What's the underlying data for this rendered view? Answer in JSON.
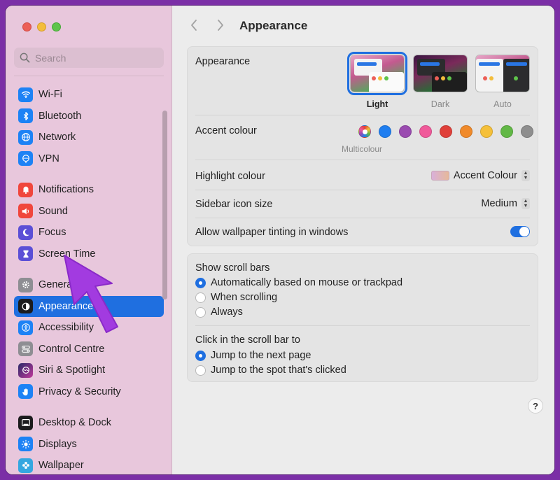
{
  "search": {
    "placeholder": "Search"
  },
  "sidebar": {
    "groups": [
      [
        {
          "label": "Wi-Fi",
          "icon": "wifi-icon",
          "color": "#1d82f5"
        },
        {
          "label": "Bluetooth",
          "icon": "bluetooth-icon",
          "color": "#1d82f5"
        },
        {
          "label": "Network",
          "icon": "globe-icon",
          "color": "#1d82f5"
        },
        {
          "label": "VPN",
          "icon": "vpn-icon",
          "color": "#1d82f5"
        }
      ],
      [
        {
          "label": "Notifications",
          "icon": "bell-icon",
          "color": "#f0463c"
        },
        {
          "label": "Sound",
          "icon": "speaker-icon",
          "color": "#f0463c"
        },
        {
          "label": "Focus",
          "icon": "moon-icon",
          "color": "#5b4fd6"
        },
        {
          "label": "Screen Time",
          "icon": "hourglass-icon",
          "color": "#5b4fd6"
        }
      ],
      [
        {
          "label": "General",
          "icon": "gear-icon",
          "color": "#8e8e93"
        },
        {
          "label": "Appearance",
          "icon": "appearance-icon",
          "color": "#1c1c1e",
          "active": true
        },
        {
          "label": "Accessibility",
          "icon": "accessibility-icon",
          "color": "#1d82f5"
        },
        {
          "label": "Control Centre",
          "icon": "control-centre-icon",
          "color": "#8e8e93"
        },
        {
          "label": "Siri & Spotlight",
          "icon": "siri-icon",
          "color": "#6a3bd1"
        },
        {
          "label": "Privacy & Security",
          "icon": "hand-icon",
          "color": "#1d82f5"
        }
      ],
      [
        {
          "label": "Desktop & Dock",
          "icon": "dock-icon",
          "color": "#1c1c1e"
        },
        {
          "label": "Displays",
          "icon": "sun-icon",
          "color": "#1d82f5"
        },
        {
          "label": "Wallpaper",
          "icon": "wallpaper-icon",
          "color": "#34a7e0"
        }
      ]
    ]
  },
  "header": {
    "title": "Appearance"
  },
  "appearance": {
    "label": "Appearance",
    "themes": [
      {
        "label": "Light",
        "selected": true
      },
      {
        "label": "Dark",
        "selected": false
      },
      {
        "label": "Auto",
        "selected": false
      }
    ]
  },
  "accent": {
    "label": "Accent colour",
    "selected_label": "Multicolour",
    "colors": [
      "#1f7ef0",
      "#9a4bb0",
      "#f05a9a",
      "#e0403a",
      "#f08a2a",
      "#f5c03a",
      "#62b846",
      "#8e8e8e"
    ]
  },
  "highlight": {
    "label": "Highlight colour",
    "value": "Accent Colour"
  },
  "icon_size": {
    "label": "Sidebar icon size",
    "value": "Medium"
  },
  "tinting": {
    "label": "Allow wallpaper tinting in windows",
    "on": true
  },
  "scrollbars": {
    "heading": "Show scroll bars",
    "options": [
      {
        "label": "Automatically based on mouse or trackpad",
        "selected": true
      },
      {
        "label": "When scrolling",
        "selected": false
      },
      {
        "label": "Always",
        "selected": false
      }
    ]
  },
  "click_scroll": {
    "heading": "Click in the scroll bar to",
    "options": [
      {
        "label": "Jump to the next page",
        "selected": true
      },
      {
        "label": "Jump to the spot that's clicked",
        "selected": false
      }
    ]
  },
  "help": {
    "label": "?"
  }
}
